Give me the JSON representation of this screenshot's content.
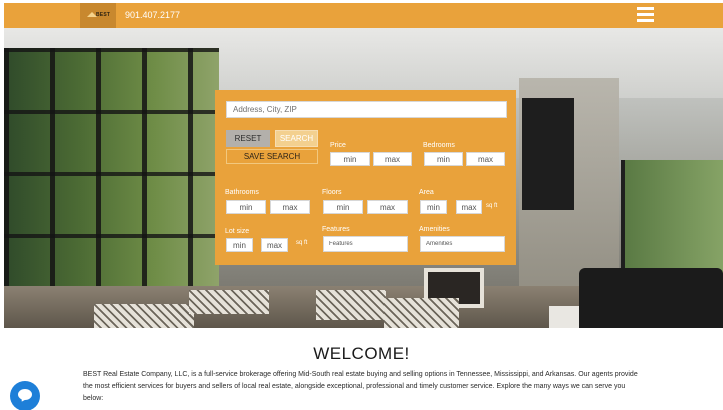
{
  "header": {
    "logo_text": "BEST",
    "phone": "901.407.2177"
  },
  "search": {
    "address_placeholder": "Address, City, ZIP",
    "reset_label": "RESET",
    "search_label": "SEARCH",
    "save_label": "SAVE SEARCH",
    "price": {
      "label": "Price",
      "min": "min",
      "max": "max"
    },
    "bedrooms": {
      "label": "Bedrooms",
      "min": "min",
      "max": "max"
    },
    "bathrooms": {
      "label": "Bathrooms",
      "min": "min",
      "max": "max"
    },
    "floors": {
      "label": "Floors",
      "min": "min",
      "max": "max"
    },
    "area": {
      "label": "Area",
      "min": "min",
      "max": "max",
      "unit": "sq ft"
    },
    "lot_size": {
      "label": "Lot size",
      "min": "min",
      "max": "max",
      "unit": "sq ft"
    },
    "features": {
      "label": "Features",
      "placeholder": "Features"
    },
    "amenities": {
      "label": "Amenities",
      "placeholder": "Amenities"
    }
  },
  "welcome": {
    "title": "WELCOME!",
    "body": "BEST Real Estate Company, LLC, is a full-service brokerage offering Mid-South real estate buying and selling options in Tennessee, Mississippi, and Arkansas. Our agents provide the most efficient services for buyers and sellers of local real estate, alongside exceptional, professional and timely customer service. Explore the many ways we can serve you below:"
  },
  "icons": {
    "menu": "hamburger-menu-icon",
    "chat": "chat-bubble-icon",
    "logo": "roof-logo-icon"
  },
  "colors": {
    "brand": "#e9a23b",
    "chat": "#1e7fd8"
  }
}
